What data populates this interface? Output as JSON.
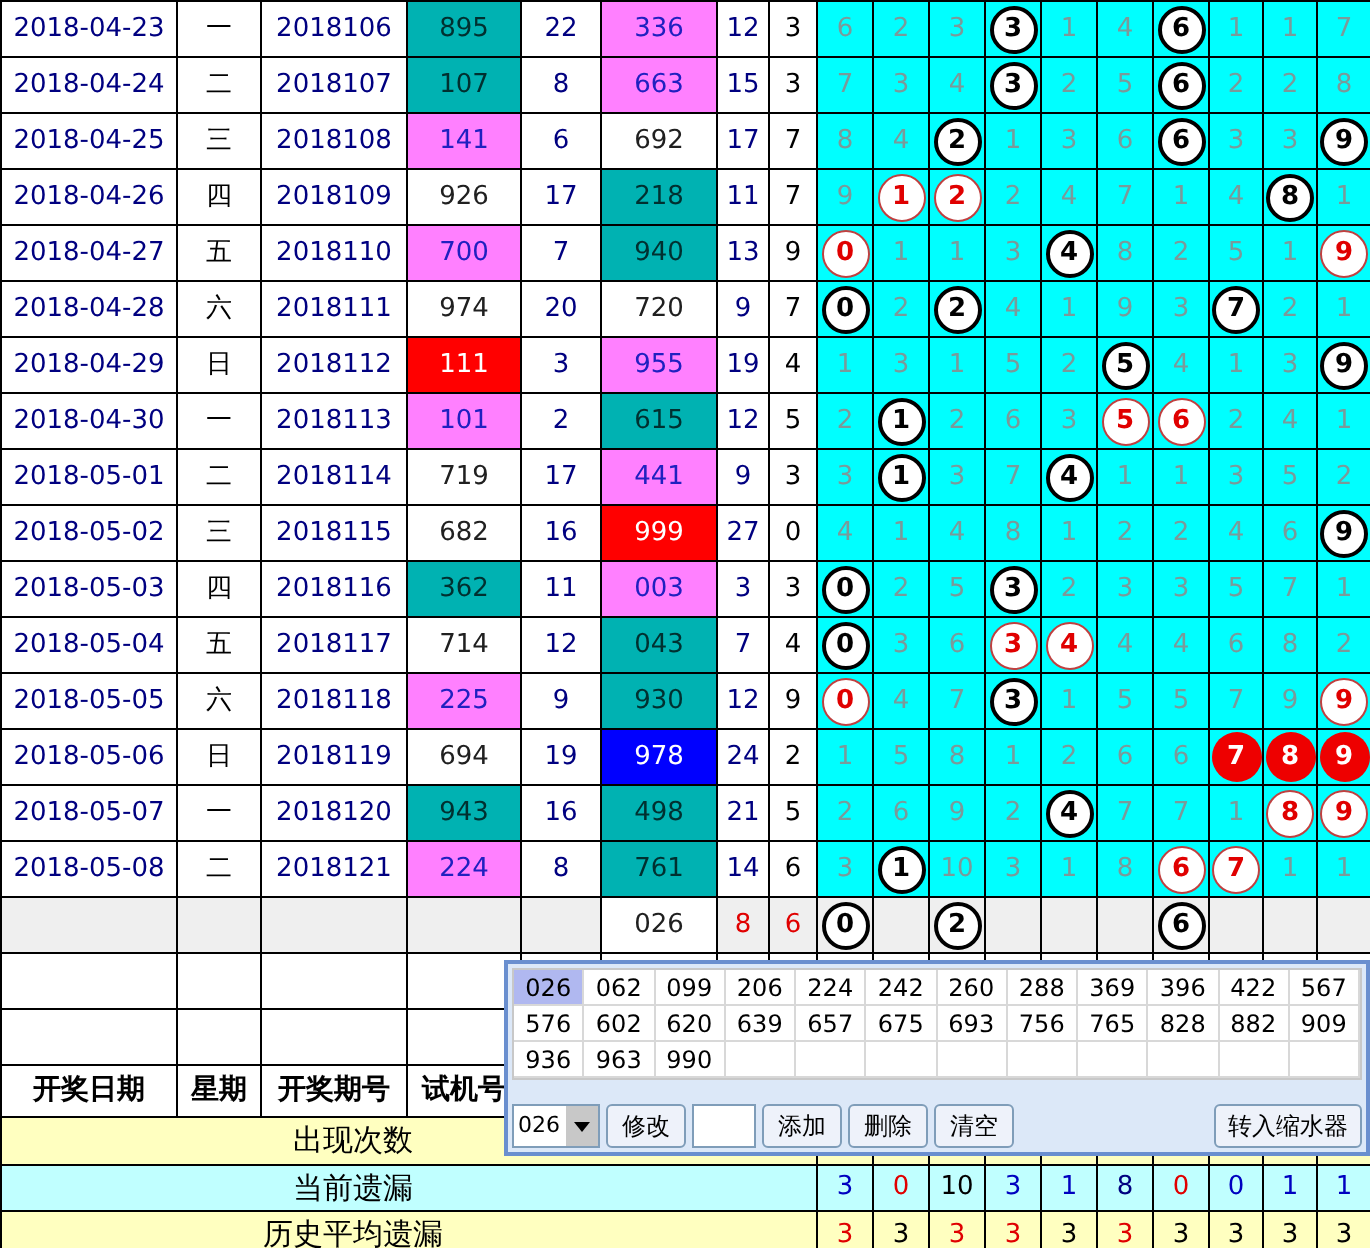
{
  "rows": [
    {
      "date": "2018-04-23",
      "weekday": "一",
      "issue": "2018106",
      "trial": {
        "text": "895",
        "color": "#00b2b2"
      },
      "col_5": "22",
      "result": {
        "text": "336",
        "color": "#ff80ff"
      },
      "col_7": "12",
      "col_8": "3",
      "digits": [
        {
          "text": "6",
          "kind": "plain"
        },
        {
          "text": "2",
          "kind": "plain"
        },
        {
          "text": "3",
          "kind": "plain"
        },
        {
          "text": "3",
          "kind": "ball"
        },
        {
          "text": "1",
          "kind": "plain"
        },
        {
          "text": "4",
          "kind": "plain"
        },
        {
          "text": "6",
          "kind": "ball"
        },
        {
          "text": "1",
          "kind": "plain"
        },
        {
          "text": "1",
          "kind": "plain"
        },
        {
          "text": "7",
          "kind": "plain"
        }
      ]
    },
    {
      "date": "2018-04-24",
      "weekday": "二",
      "issue": "2018107",
      "trial": {
        "text": "107",
        "color": "#00b2b2"
      },
      "col_5": "8",
      "result": {
        "text": "663",
        "color": "#ff80ff"
      },
      "col_7": "15",
      "col_8": "3",
      "digits": [
        {
          "text": "7",
          "kind": "plain"
        },
        {
          "text": "3",
          "kind": "plain"
        },
        {
          "text": "4",
          "kind": "plain"
        },
        {
          "text": "3",
          "kind": "ball"
        },
        {
          "text": "2",
          "kind": "plain"
        },
        {
          "text": "5",
          "kind": "plain"
        },
        {
          "text": "6",
          "kind": "ball"
        },
        {
          "text": "2",
          "kind": "plain"
        },
        {
          "text": "2",
          "kind": "plain"
        },
        {
          "text": "8",
          "kind": "plain"
        }
      ]
    },
    {
      "date": "2018-04-25",
      "weekday": "三",
      "issue": "2018108",
      "trial": {
        "text": "141",
        "color": "#ff80ff"
      },
      "col_5": "6",
      "result": {
        "text": "692",
        "color": "#ffffff"
      },
      "col_7": "17",
      "col_8": "7",
      "digits": [
        {
          "text": "8",
          "kind": "plain"
        },
        {
          "text": "4",
          "kind": "plain"
        },
        {
          "text": "2",
          "kind": "ball"
        },
        {
          "text": "1",
          "kind": "plain"
        },
        {
          "text": "3",
          "kind": "plain"
        },
        {
          "text": "6",
          "kind": "plain"
        },
        {
          "text": "6",
          "kind": "ball"
        },
        {
          "text": "3",
          "kind": "plain"
        },
        {
          "text": "3",
          "kind": "plain"
        },
        {
          "text": "9",
          "kind": "ball"
        }
      ]
    },
    {
      "date": "2018-04-26",
      "weekday": "四",
      "issue": "2018109",
      "trial": {
        "text": "926",
        "color": "#ffffff"
      },
      "col_5": "17",
      "result": {
        "text": "218",
        "color": "#00b2b2"
      },
      "col_7": "11",
      "col_8": "7",
      "digits": [
        {
          "text": "9",
          "kind": "plain"
        },
        {
          "text": "1",
          "kind": "red_ball"
        },
        {
          "text": "2",
          "kind": "red_ball"
        },
        {
          "text": "2",
          "kind": "plain"
        },
        {
          "text": "4",
          "kind": "plain"
        },
        {
          "text": "7",
          "kind": "plain"
        },
        {
          "text": "1",
          "kind": "plain"
        },
        {
          "text": "4",
          "kind": "plain"
        },
        {
          "text": "8",
          "kind": "ball"
        },
        {
          "text": "1",
          "kind": "plain"
        }
      ]
    },
    {
      "date": "2018-04-27",
      "weekday": "五",
      "issue": "2018110",
      "trial": {
        "text": "700",
        "color": "#ff80ff"
      },
      "col_5": "7",
      "result": {
        "text": "940",
        "color": "#00b2b2"
      },
      "col_7": "13",
      "col_8": "9",
      "digits": [
        {
          "text": "0",
          "kind": "red_ball"
        },
        {
          "text": "1",
          "kind": "plain"
        },
        {
          "text": "1",
          "kind": "plain"
        },
        {
          "text": "3",
          "kind": "plain"
        },
        {
          "text": "4",
          "kind": "ball"
        },
        {
          "text": "8",
          "kind": "plain"
        },
        {
          "text": "2",
          "kind": "plain"
        },
        {
          "text": "5",
          "kind": "plain"
        },
        {
          "text": "1",
          "kind": "plain"
        },
        {
          "text": "9",
          "kind": "red_ball"
        }
      ]
    },
    {
      "date": "2018-04-28",
      "weekday": "六",
      "issue": "2018111",
      "trial": {
        "text": "974",
        "color": "#ffffff"
      },
      "col_5": "20",
      "result": {
        "text": "720",
        "color": "#ffffff"
      },
      "col_7": "9",
      "col_8": "7",
      "digits": [
        {
          "text": "0",
          "kind": "ball"
        },
        {
          "text": "2",
          "kind": "plain"
        },
        {
          "text": "2",
          "kind": "ball"
        },
        {
          "text": "4",
          "kind": "plain"
        },
        {
          "text": "1",
          "kind": "plain"
        },
        {
          "text": "9",
          "kind": "plain"
        },
        {
          "text": "3",
          "kind": "plain"
        },
        {
          "text": "7",
          "kind": "ball"
        },
        {
          "text": "2",
          "kind": "plain"
        },
        {
          "text": "1",
          "kind": "plain"
        }
      ]
    },
    {
      "date": "2018-04-29",
      "weekday": "日",
      "issue": "2018112",
      "trial": {
        "text": "111",
        "color": "#ff0000"
      },
      "col_5": "3",
      "result": {
        "text": "955",
        "color": "#ff80ff"
      },
      "col_7": "19",
      "col_8": "4",
      "digits": [
        {
          "text": "1",
          "kind": "plain"
        },
        {
          "text": "3",
          "kind": "plain"
        },
        {
          "text": "1",
          "kind": "plain"
        },
        {
          "text": "5",
          "kind": "plain"
        },
        {
          "text": "2",
          "kind": "plain"
        },
        {
          "text": "5",
          "kind": "ball"
        },
        {
          "text": "4",
          "kind": "plain"
        },
        {
          "text": "1",
          "kind": "plain"
        },
        {
          "text": "3",
          "kind": "plain"
        },
        {
          "text": "9",
          "kind": "ball"
        }
      ]
    },
    {
      "date": "2018-04-30",
      "weekday": "一",
      "issue": "2018113",
      "trial": {
        "text": "101",
        "color": "#ff80ff"
      },
      "col_5": "2",
      "result": {
        "text": "615",
        "color": "#00b2b2"
      },
      "col_7": "12",
      "col_8": "5",
      "digits": [
        {
          "text": "2",
          "kind": "plain"
        },
        {
          "text": "1",
          "kind": "ball"
        },
        {
          "text": "2",
          "kind": "plain"
        },
        {
          "text": "6",
          "kind": "plain"
        },
        {
          "text": "3",
          "kind": "plain"
        },
        {
          "text": "5",
          "kind": "red_ball"
        },
        {
          "text": "6",
          "kind": "red_ball"
        },
        {
          "text": "2",
          "kind": "plain"
        },
        {
          "text": "4",
          "kind": "plain"
        },
        {
          "text": "1",
          "kind": "plain"
        }
      ]
    },
    {
      "date": "2018-05-01",
      "weekday": "二",
      "issue": "2018114",
      "trial": {
        "text": "719",
        "color": "#ffffff"
      },
      "col_5": "17",
      "result": {
        "text": "441",
        "color": "#ff80ff"
      },
      "col_7": "9",
      "col_8": "3",
      "digits": [
        {
          "text": "3",
          "kind": "plain"
        },
        {
          "text": "1",
          "kind": "ball"
        },
        {
          "text": "3",
          "kind": "plain"
        },
        {
          "text": "7",
          "kind": "plain"
        },
        {
          "text": "4",
          "kind": "ball"
        },
        {
          "text": "1",
          "kind": "plain"
        },
        {
          "text": "1",
          "kind": "plain"
        },
        {
          "text": "3",
          "kind": "plain"
        },
        {
          "text": "5",
          "kind": "plain"
        },
        {
          "text": "2",
          "kind": "plain"
        }
      ]
    },
    {
      "date": "2018-05-02",
      "weekday": "三",
      "issue": "2018115",
      "trial": {
        "text": "682",
        "color": "#ffffff"
      },
      "col_5": "16",
      "result": {
        "text": "999",
        "color": "#ff0000"
      },
      "col_7": "27",
      "col_8": "0",
      "digits": [
        {
          "text": "4",
          "kind": "plain"
        },
        {
          "text": "1",
          "kind": "plain"
        },
        {
          "text": "4",
          "kind": "plain"
        },
        {
          "text": "8",
          "kind": "plain"
        },
        {
          "text": "1",
          "kind": "plain"
        },
        {
          "text": "2",
          "kind": "plain"
        },
        {
          "text": "2",
          "kind": "plain"
        },
        {
          "text": "4",
          "kind": "plain"
        },
        {
          "text": "6",
          "kind": "plain"
        },
        {
          "text": "9",
          "kind": "ball"
        }
      ]
    },
    {
      "date": "2018-05-03",
      "weekday": "四",
      "issue": "2018116",
      "trial": {
        "text": "362",
        "color": "#00b2b2"
      },
      "col_5": "11",
      "result": {
        "text": "003",
        "color": "#ff80ff"
      },
      "col_7": "3",
      "col_8": "3",
      "digits": [
        {
          "text": "0",
          "kind": "ball"
        },
        {
          "text": "2",
          "kind": "plain"
        },
        {
          "text": "5",
          "kind": "plain"
        },
        {
          "text": "3",
          "kind": "ball"
        },
        {
          "text": "2",
          "kind": "plain"
        },
        {
          "text": "3",
          "kind": "plain"
        },
        {
          "text": "3",
          "kind": "plain"
        },
        {
          "text": "5",
          "kind": "plain"
        },
        {
          "text": "7",
          "kind": "plain"
        },
        {
          "text": "1",
          "kind": "plain"
        }
      ]
    },
    {
      "date": "2018-05-04",
      "weekday": "五",
      "issue": "2018117",
      "trial": {
        "text": "714",
        "color": "#ffffff"
      },
      "col_5": "12",
      "result": {
        "text": "043",
        "color": "#00b2b2"
      },
      "col_7": "7",
      "col_8": "4",
      "digits": [
        {
          "text": "0",
          "kind": "ball"
        },
        {
          "text": "3",
          "kind": "plain"
        },
        {
          "text": "6",
          "kind": "plain"
        },
        {
          "text": "3",
          "kind": "red_ball"
        },
        {
          "text": "4",
          "kind": "red_ball"
        },
        {
          "text": "4",
          "kind": "plain"
        },
        {
          "text": "4",
          "kind": "plain"
        },
        {
          "text": "6",
          "kind": "plain"
        },
        {
          "text": "8",
          "kind": "plain"
        },
        {
          "text": "2",
          "kind": "plain"
        }
      ]
    },
    {
      "date": "2018-05-05",
      "weekday": "六",
      "issue": "2018118",
      "trial": {
        "text": "225",
        "color": "#ff80ff"
      },
      "col_5": "9",
      "result": {
        "text": "930",
        "color": "#00b2b2"
      },
      "col_7": "12",
      "col_8": "9",
      "digits": [
        {
          "text": "0",
          "kind": "red_ball"
        },
        {
          "text": "4",
          "kind": "plain"
        },
        {
          "text": "7",
          "kind": "plain"
        },
        {
          "text": "3",
          "kind": "ball"
        },
        {
          "text": "1",
          "kind": "plain"
        },
        {
          "text": "5",
          "kind": "plain"
        },
        {
          "text": "5",
          "kind": "plain"
        },
        {
          "text": "7",
          "kind": "plain"
        },
        {
          "text": "9",
          "kind": "plain"
        },
        {
          "text": "9",
          "kind": "red_ball"
        }
      ]
    },
    {
      "date": "2018-05-06",
      "weekday": "日",
      "issue": "2018119",
      "trial": {
        "text": "694",
        "color": "#ffffff"
      },
      "col_5": "19",
      "result": {
        "text": "978",
        "color": "#0000ff"
      },
      "col_7": "24",
      "col_8": "2",
      "digits": [
        {
          "text": "1",
          "kind": "plain"
        },
        {
          "text": "5",
          "kind": "plain"
        },
        {
          "text": "8",
          "kind": "plain"
        },
        {
          "text": "1",
          "kind": "plain"
        },
        {
          "text": "2",
          "kind": "plain"
        },
        {
          "text": "6",
          "kind": "plain"
        },
        {
          "text": "6",
          "kind": "plain"
        },
        {
          "text": "7",
          "kind": "filled_ball"
        },
        {
          "text": "8",
          "kind": "filled_ball"
        },
        {
          "text": "9",
          "kind": "filled_ball"
        }
      ]
    },
    {
      "date": "2018-05-07",
      "weekday": "一",
      "issue": "2018120",
      "trial": {
        "text": "943",
        "color": "#00b2b2"
      },
      "col_5": "16",
      "result": {
        "text": "498",
        "color": "#00b2b2"
      },
      "col_7": "21",
      "col_8": "5",
      "digits": [
        {
          "text": "2",
          "kind": "plain"
        },
        {
          "text": "6",
          "kind": "plain"
        },
        {
          "text": "9",
          "kind": "plain"
        },
        {
          "text": "2",
          "kind": "plain"
        },
        {
          "text": "4",
          "kind": "ball"
        },
        {
          "text": "7",
          "kind": "plain"
        },
        {
          "text": "7",
          "kind": "plain"
        },
        {
          "text": "1",
          "kind": "plain"
        },
        {
          "text": "8",
          "kind": "red_ball"
        },
        {
          "text": "9",
          "kind": "red_ball"
        }
      ]
    },
    {
      "date": "2018-05-08",
      "weekday": "二",
      "issue": "2018121",
      "trial": {
        "text": "224",
        "color": "#ff80ff"
      },
      "col_5": "8",
      "result": {
        "text": "761",
        "color": "#00b2b2"
      },
      "col_7": "14",
      "col_8": "6",
      "digits": [
        {
          "text": "3",
          "kind": "plain"
        },
        {
          "text": "1",
          "kind": "ball"
        },
        {
          "text": "10",
          "kind": "plain"
        },
        {
          "text": "3",
          "kind": "plain"
        },
        {
          "text": "1",
          "kind": "plain"
        },
        {
          "text": "8",
          "kind": "plain"
        },
        {
          "text": "6",
          "kind": "red_ball"
        },
        {
          "text": "7",
          "kind": "red_ball"
        },
        {
          "text": "1",
          "kind": "plain"
        },
        {
          "text": "1",
          "kind": "plain"
        }
      ]
    }
  ],
  "summary": {
    "result": "026",
    "col_7": "8",
    "col_8": "6",
    "digits": [
      {
        "text": "0",
        "kind": "ball"
      },
      {
        "kind": "blank"
      },
      {
        "text": "2",
        "kind": "ball"
      },
      {
        "kind": "blank"
      },
      {
        "kind": "blank"
      },
      {
        "kind": "blank"
      },
      {
        "text": "6",
        "kind": "ball"
      },
      {
        "kind": "blank"
      },
      {
        "kind": "blank"
      },
      {
        "kind": "blank"
      }
    ]
  },
  "header": [
    "开奖日期",
    "星期",
    "开奖期号",
    "试机号"
  ],
  "stats": [
    {
      "label": "出现次数",
      "kind": "yellow"
    },
    {
      "label": "当前遗漏",
      "kind": "cyan",
      "values": [
        {
          "text": "3",
          "color": "#0000c0"
        },
        {
          "text": "0",
          "color": "#e00000"
        },
        {
          "text": "10",
          "color": "#000000"
        },
        {
          "text": "3",
          "color": "#0000c0"
        },
        {
          "text": "1",
          "color": "#0000c0"
        },
        {
          "text": "8",
          "color": "#000080"
        },
        {
          "text": "0",
          "color": "#e00000"
        },
        {
          "text": "0",
          "color": "#0000c0"
        },
        {
          "text": "1",
          "color": "#0000c0"
        },
        {
          "text": "1",
          "color": "#0000c0"
        }
      ]
    },
    {
      "label": "历史平均遗漏",
      "kind": "yellow",
      "values": [
        {
          "text": "3",
          "color": "#e00000"
        },
        {
          "text": "3",
          "color": "#000000"
        },
        {
          "text": "3",
          "color": "#e00000"
        },
        {
          "text": "3",
          "color": "#e00000"
        },
        {
          "text": "3",
          "color": "#000000"
        },
        {
          "text": "3",
          "color": "#e00000"
        },
        {
          "text": "3",
          "color": "#000000"
        },
        {
          "text": "3",
          "color": "#000000"
        },
        {
          "text": "3",
          "color": "#000000"
        },
        {
          "text": "3",
          "color": "#000000"
        }
      ]
    }
  ],
  "popup": {
    "numbers": [
      {
        "text": "026",
        "selected": true
      },
      {
        "text": "062",
        "selected": false
      },
      {
        "text": "099",
        "selected": false
      },
      {
        "text": "206",
        "selected": false
      },
      {
        "text": "224",
        "selected": false
      },
      {
        "text": "242",
        "selected": false
      },
      {
        "text": "260",
        "selected": false
      },
      {
        "text": "288",
        "selected": false
      },
      {
        "text": "369",
        "selected": false
      },
      {
        "text": "396",
        "selected": false
      },
      {
        "text": "422",
        "selected": false
      },
      {
        "text": "567",
        "selected": false
      },
      {
        "text": "576",
        "selected": false
      },
      {
        "text": "602",
        "selected": false
      },
      {
        "text": "620",
        "selected": false
      },
      {
        "text": "639",
        "selected": false
      },
      {
        "text": "657",
        "selected": false
      },
      {
        "text": "675",
        "selected": false
      },
      {
        "text": "693",
        "selected": false
      },
      {
        "text": "756",
        "selected": false
      },
      {
        "text": "765",
        "selected": false
      },
      {
        "text": "828",
        "selected": false
      },
      {
        "text": "882",
        "selected": false
      },
      {
        "text": "909",
        "selected": false
      },
      {
        "text": "936",
        "selected": false
      },
      {
        "text": "963",
        "selected": false
      },
      {
        "text": "990",
        "selected": false
      }
    ],
    "select_value": "026",
    "controls": [
      {
        "kind": "button",
        "label": "修改"
      },
      {
        "kind": "input"
      },
      {
        "kind": "button",
        "label": "添加"
      },
      {
        "kind": "button",
        "label": "删除"
      },
      {
        "kind": "button",
        "label": "清空"
      }
    ],
    "transfer_button": "转入缩水器"
  }
}
